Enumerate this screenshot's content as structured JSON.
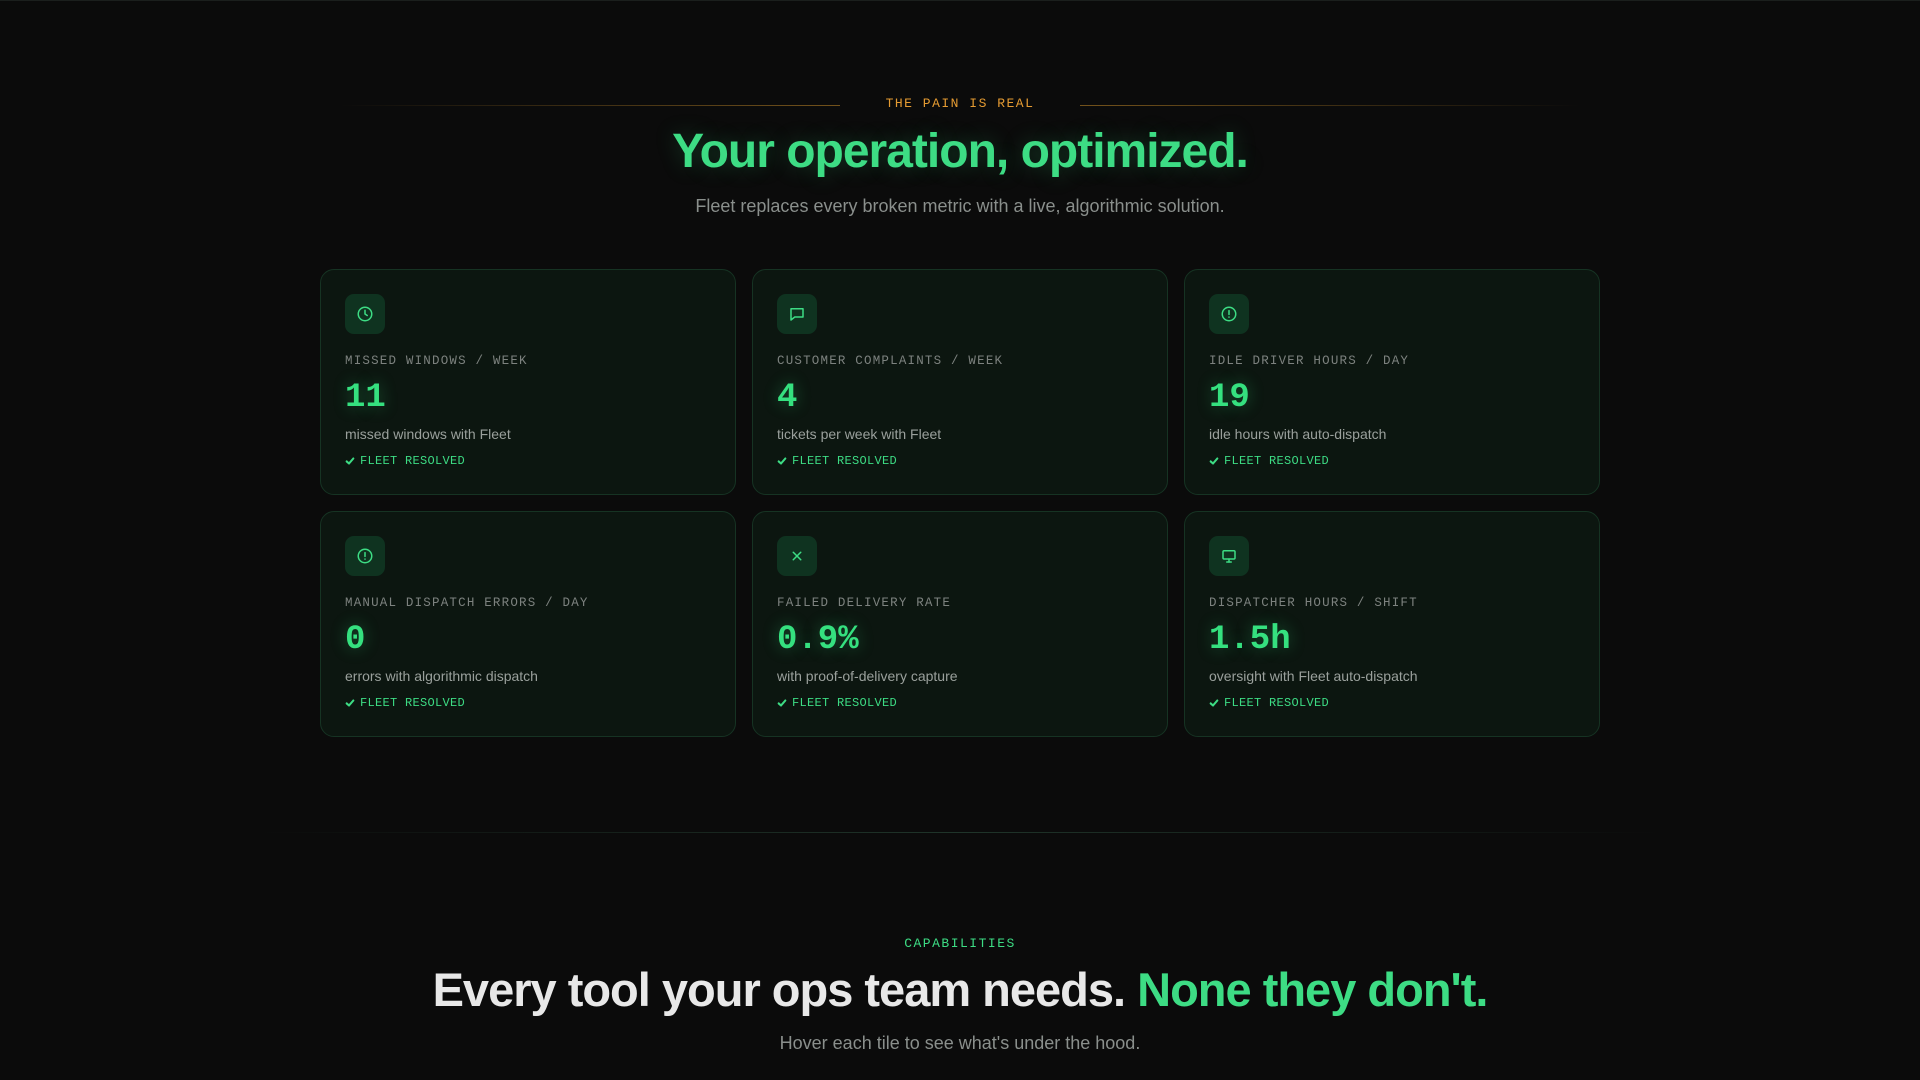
{
  "pain_section": {
    "eyebrow": "THE PAIN IS REAL",
    "title": "Your operation, optimized.",
    "subtitle": "Fleet replaces every broken metric with a live, algorithmic solution.",
    "cards": [
      {
        "icon": "clock-icon",
        "label": "MISSED WINDOWS / WEEK",
        "value": "11",
        "description": "missed windows with Fleet",
        "status": "FLEET RESOLVED"
      },
      {
        "icon": "message-icon",
        "label": "CUSTOMER COMPLAINTS / WEEK",
        "value": "4",
        "description": "tickets per week with Fleet",
        "status": "FLEET RESOLVED"
      },
      {
        "icon": "alert-circle-icon",
        "label": "IDLE DRIVER HOURS / DAY",
        "value": "19",
        "description": "idle hours with auto-dispatch",
        "status": "FLEET RESOLVED"
      },
      {
        "icon": "alert-circle-icon",
        "label": "MANUAL DISPATCH ERRORS / DAY",
        "value": "0",
        "description": "errors with algorithmic dispatch",
        "status": "FLEET RESOLVED"
      },
      {
        "icon": "x-icon",
        "label": "FAILED DELIVERY RATE",
        "value": "0.9%",
        "description": "with proof-of-delivery capture",
        "status": "FLEET RESOLVED"
      },
      {
        "icon": "monitor-icon",
        "label": "DISPATCHER HOURS / SHIFT",
        "value": "1.5h",
        "description": "oversight with Fleet auto-dispatch",
        "status": "FLEET RESOLVED"
      }
    ]
  },
  "capabilities_section": {
    "eyebrow": "CAPABILITIES",
    "title_main": "Every tool your ops team needs.",
    "title_accent": "None they don't.",
    "subtitle": "Hover each tile to see what's under the hood."
  },
  "colors": {
    "background": "#0b0b0b",
    "accent_green": "#3ddc84",
    "eyebrow_orange": "#e59b32",
    "card_background": "#0c1610",
    "card_border": "#163323",
    "muted_text": "#8a8f8c"
  }
}
